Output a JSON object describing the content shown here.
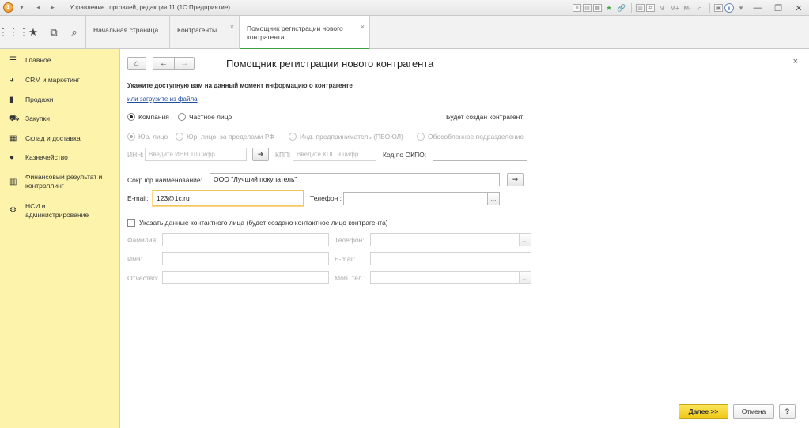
{
  "window": {
    "title": "Управление торговлей, редакция 11  (1С:Предприятие)",
    "icons": [
      "1c-logo-icon",
      "dropdown-icon",
      "back-icon",
      "forward-icon"
    ],
    "title_m": "M",
    "title_mplus": "M+",
    "title_mminus": "M-"
  },
  "tabs": {
    "home": "Начальная страница",
    "contractors": "Контрагенты",
    "wizard": "Помощник регистрации нового контрагента"
  },
  "sidebar": {
    "items": [
      {
        "label": "Главное",
        "icon": "menu-icon"
      },
      {
        "label": "CRM и маркетинг",
        "icon": "crm-icon"
      },
      {
        "label": "Продажи",
        "icon": "bag-icon"
      },
      {
        "label": "Закупки",
        "icon": "cart-icon"
      },
      {
        "label": "Склад и доставка",
        "icon": "warehouse-icon"
      },
      {
        "label": "Казначейство",
        "icon": "coin-icon"
      },
      {
        "label": "Финансовый результат и контроллинг",
        "icon": "chart-icon"
      },
      {
        "label": "НСИ и администрирование",
        "icon": "gear-icon"
      }
    ]
  },
  "form": {
    "title": "Помощник регистрации нового контрагента",
    "hint": "Укажите доступную вам на данный момент информацию о контрагенте",
    "load_link": "или загрузите из файла",
    "type_company": "Компания",
    "type_person": "Частное лицо",
    "will_create": "Будет создан контрагент",
    "kind_legal": "Юр. лицо",
    "kind_foreign": "Юр. лицо, за пределами РФ",
    "kind_ip": "Инд. предприниматель (ПБОЮЛ)",
    "kind_branch": "Обособленное подразделение",
    "inn_label": "ИНН:",
    "inn_placeholder": "Введите ИНН 10 цифр",
    "kpp_label": "КПП:",
    "kpp_placeholder": "Введите КПП 9 цифр",
    "okpo_label": "Код по ОКПО:",
    "okpo_value": "",
    "shortname_label": "Сокр.юр.наименование:",
    "shortname_value": "ООО \"Лучший покупатель\"",
    "email_label": "E-mail:",
    "email_value": "123@1c.ru",
    "phone_label": "Телефон :",
    "phone_value": "",
    "select_btn": "...",
    "contact_check": "Указать данные контактного лица (будет создано контактное лицо контрагента)",
    "c_lastname": "Фамилия:",
    "c_firstname": "Имя:",
    "c_middlename": "Отчество:",
    "c_phone": "Телефон:",
    "c_email": "E-mail:",
    "c_mobile": "Моб. тел.:"
  },
  "buttons": {
    "next": "Далее >>",
    "cancel": "Отмена",
    "help": "?"
  },
  "colors": {
    "sidebar_bg": "#fdf3ab",
    "primary_button": "#f5d538",
    "active_tab_underline": "#3aa141",
    "link": "#1c4aa0"
  }
}
